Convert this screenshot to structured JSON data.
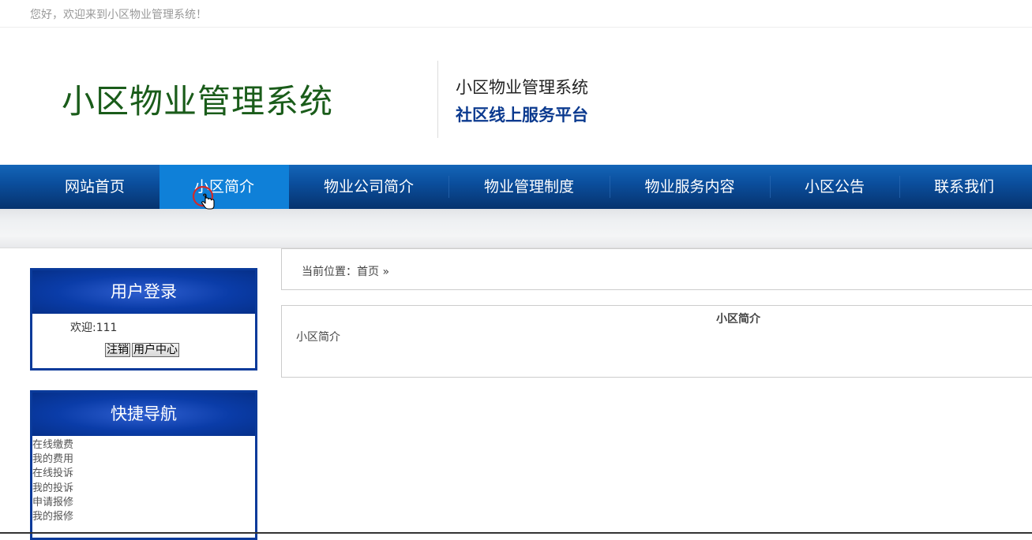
{
  "topbar": {
    "greeting": "您好，欢迎来到小区物业管理系统！"
  },
  "header": {
    "logo": "小区物业管理系统",
    "subtitle_1": "小区物业管理系统",
    "subtitle_2": "社区线上服务平台"
  },
  "nav": {
    "items": [
      {
        "label": "网站首页"
      },
      {
        "label": "小区简介"
      },
      {
        "label": "物业公司简介"
      },
      {
        "label": "物业管理制度"
      },
      {
        "label": "物业服务内容"
      },
      {
        "label": "小区公告"
      },
      {
        "label": "联系我们"
      }
    ]
  },
  "login": {
    "title": "用户登录",
    "welcome": "欢迎:111",
    "logout_label": "注销",
    "user_center_label": "用户中心"
  },
  "quick_nav": {
    "title": "快捷导航",
    "items": [
      "在线缴费",
      "我的费用",
      "在线投诉",
      "我的投诉",
      "申请报修",
      "我的报修"
    ]
  },
  "breadcrumb": {
    "text": "当前位置：首页 »"
  },
  "content": {
    "title": "小区简介",
    "body": "小区简介"
  },
  "colors": {
    "nav_active": "#0f80d8",
    "nav_bg": "#0b4f9e",
    "logo": "#1a5c1a",
    "box_border": "#0a3a9a"
  }
}
